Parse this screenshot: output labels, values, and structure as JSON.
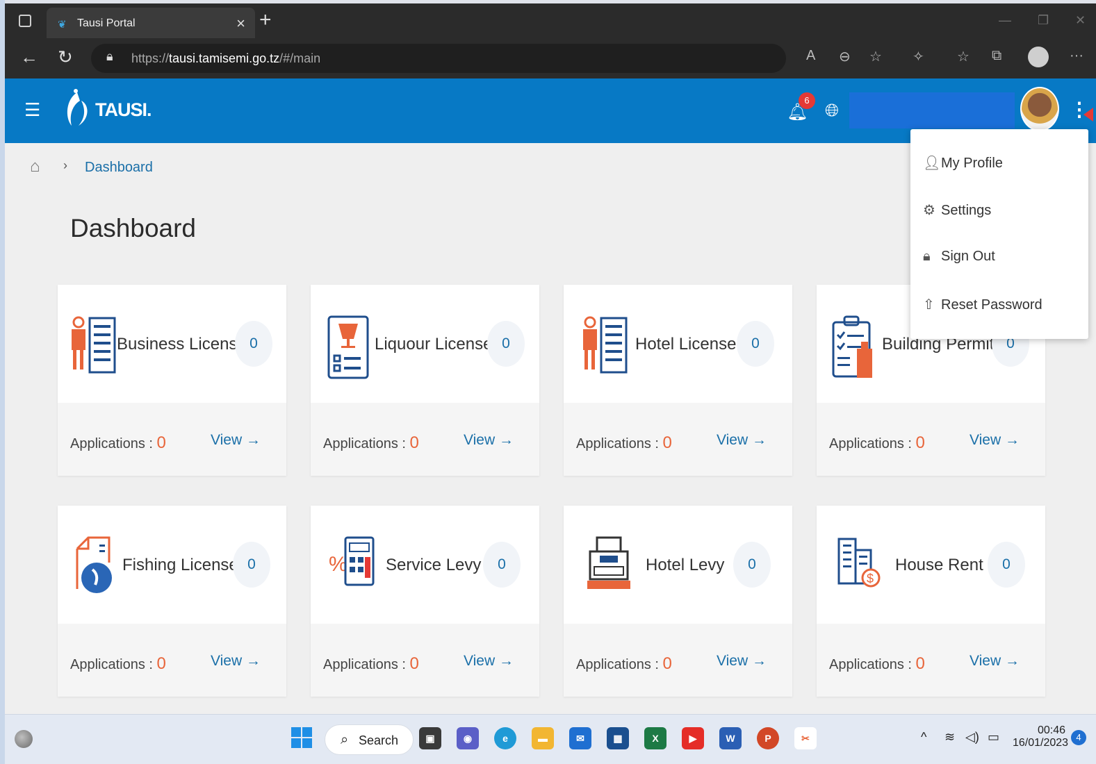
{
  "browser": {
    "tab_title": "Tausi Portal",
    "url_scheme": "https://",
    "url_host": "tausi.tamisemi.go.tz",
    "url_path": "/#/main",
    "tab_close": "×",
    "new_tab": "+",
    "more_label": "···"
  },
  "header": {
    "logo_text": "TAUSI.",
    "notification_count": "6"
  },
  "breadcrumb": {
    "current": "Dashboard"
  },
  "page_title": "Dashboard",
  "cards": [
    {
      "title": "Business License",
      "count": "0",
      "apps_label": "Applications :",
      "apps_count": "0",
      "view_label": "View →",
      "icon": "business-license-icon"
    },
    {
      "title": "Liquour License",
      "count": "0",
      "apps_label": "Applications :",
      "apps_count": "0",
      "view_label": "View →",
      "icon": "liquor-license-icon"
    },
    {
      "title": "Hotel License",
      "count": "0",
      "apps_label": "Applications :",
      "apps_count": "0",
      "view_label": "View →",
      "icon": "hotel-license-icon"
    },
    {
      "title": "Building Permit",
      "count": "0",
      "apps_label": "Applications :",
      "apps_count": "0",
      "view_label": "View →",
      "icon": "building-permit-icon"
    },
    {
      "title": "Fishing License",
      "count": "0",
      "apps_label": "Applications :",
      "apps_count": "0",
      "view_label": "View →",
      "icon": "fishing-license-icon"
    },
    {
      "title": "Service Levy",
      "count": "0",
      "apps_label": "Applications :",
      "apps_count": "0",
      "view_label": "View →",
      "icon": "service-levy-icon"
    },
    {
      "title": "Hotel Levy",
      "count": "0",
      "apps_label": "Applications :",
      "apps_count": "0",
      "view_label": "View →",
      "icon": "hotel-levy-icon"
    },
    {
      "title": "House Rent",
      "count": "0",
      "apps_label": "Applications :",
      "apps_count": "0",
      "view_label": "View →",
      "icon": "house-rent-icon"
    }
  ],
  "user_menu": {
    "items": [
      {
        "label": "My Profile",
        "icon": "user-icon"
      },
      {
        "label": "Settings",
        "icon": "gear-icon"
      },
      {
        "label": "Sign Out",
        "icon": "lock-icon"
      },
      {
        "label": "Reset Password",
        "icon": "upload-icon"
      }
    ]
  },
  "taskbar": {
    "search_label": "Search",
    "time": "00:46",
    "date": "16/01/2023",
    "notification_count": "4"
  },
  "colors": {
    "header_blue": "#0779c5",
    "link_blue": "#1a6fa8",
    "count_orange": "#e8653a",
    "badge_red": "#e53935"
  }
}
